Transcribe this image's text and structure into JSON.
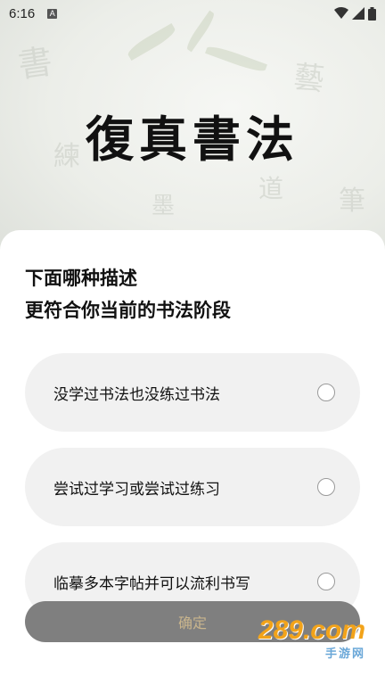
{
  "status_bar": {
    "time": "6:16",
    "notification_letter": "A"
  },
  "header": {
    "title": "復真書法"
  },
  "question": {
    "line1": "下面哪种描述",
    "line2": "更符合你当前的书法阶段"
  },
  "options": [
    {
      "label": "没学过书法也没练过书法"
    },
    {
      "label": "尝试过学习或尝试过练习"
    },
    {
      "label": "临摹多本字帖并可以流利书写"
    }
  ],
  "confirm_label": "确定",
  "watermark": {
    "brand": "289.com",
    "sub": "手游网"
  },
  "colors": {
    "sheet": "#ffffff",
    "option_bg": "#f1f1f1",
    "confirm_bg": "#7f7f7f",
    "confirm_text": "#c9b58d"
  },
  "icons": [
    "wifi-icon",
    "signal-icon",
    "battery-icon",
    "radio-icon"
  ]
}
